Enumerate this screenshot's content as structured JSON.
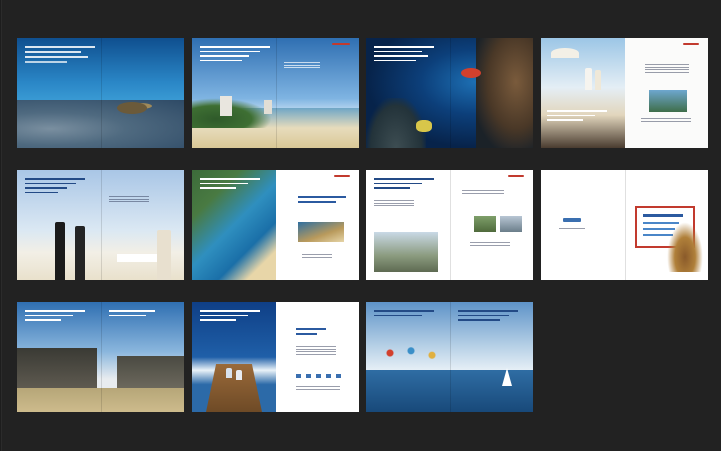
{
  "canvas": {
    "background": "#222222"
  },
  "colors": {
    "ocean_deep": "#0f3d74",
    "ocean_light": "#5fa6d9",
    "sky": "#b9d7ef",
    "sand": "#e8d6a8",
    "brand_red": "#c23a2e",
    "headline_blue": "#1e3a6b"
  },
  "spreads": [
    {
      "row": 1,
      "col": 1,
      "scene": "underwater-turtle"
    },
    {
      "row": 1,
      "col": 2,
      "scene": "beach-resort-towers"
    },
    {
      "row": 1,
      "col": 3,
      "scene": "coral-reef-diver"
    },
    {
      "row": 1,
      "col": 4,
      "scene": "terrace-couple"
    },
    {
      "row": 2,
      "col": 1,
      "scene": "beach-dining"
    },
    {
      "row": 2,
      "col": 2,
      "scene": "aerial-beach-map"
    },
    {
      "row": 2,
      "col": 3,
      "scene": "lifestyle-collage"
    },
    {
      "row": 2,
      "col": 4,
      "scene": "sailing-ship-logo"
    },
    {
      "row": 3,
      "col": 1,
      "scene": "modern-architecture"
    },
    {
      "row": 3,
      "col": 2,
      "scene": "yacht-deck"
    },
    {
      "row": 3,
      "col": 3,
      "scene": "ocean-sailboat"
    }
  ]
}
